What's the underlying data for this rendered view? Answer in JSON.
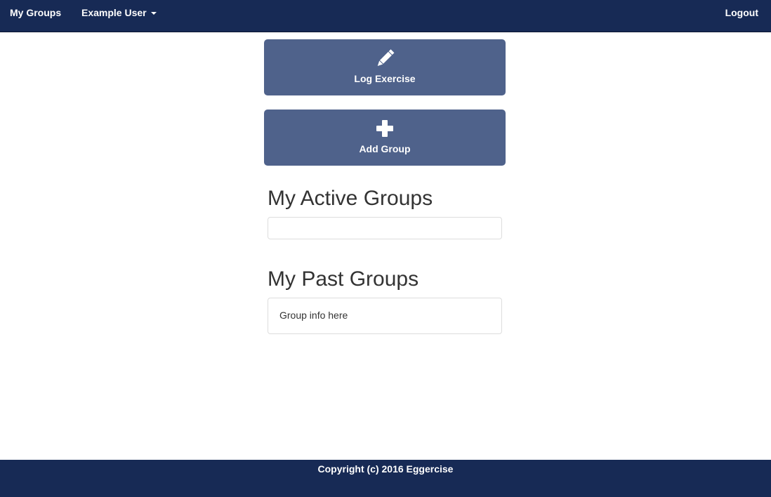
{
  "nav": {
    "my_groups": "My Groups",
    "user": "Example User",
    "logout": "Logout"
  },
  "actions": {
    "log_exercise": {
      "label": "Log Exercise",
      "icon": "pencil-icon"
    },
    "add_group": {
      "label": "Add Group",
      "icon": "plus-icon"
    }
  },
  "sections": {
    "active_title": "My Active Groups",
    "past_title": "My Past Groups",
    "past_group_text": "Group info here"
  },
  "footer": {
    "copyright": "Copyright (c) 2016 Eggercise"
  },
  "colors": {
    "navbar": "#172a55",
    "button": "#4f628b"
  }
}
